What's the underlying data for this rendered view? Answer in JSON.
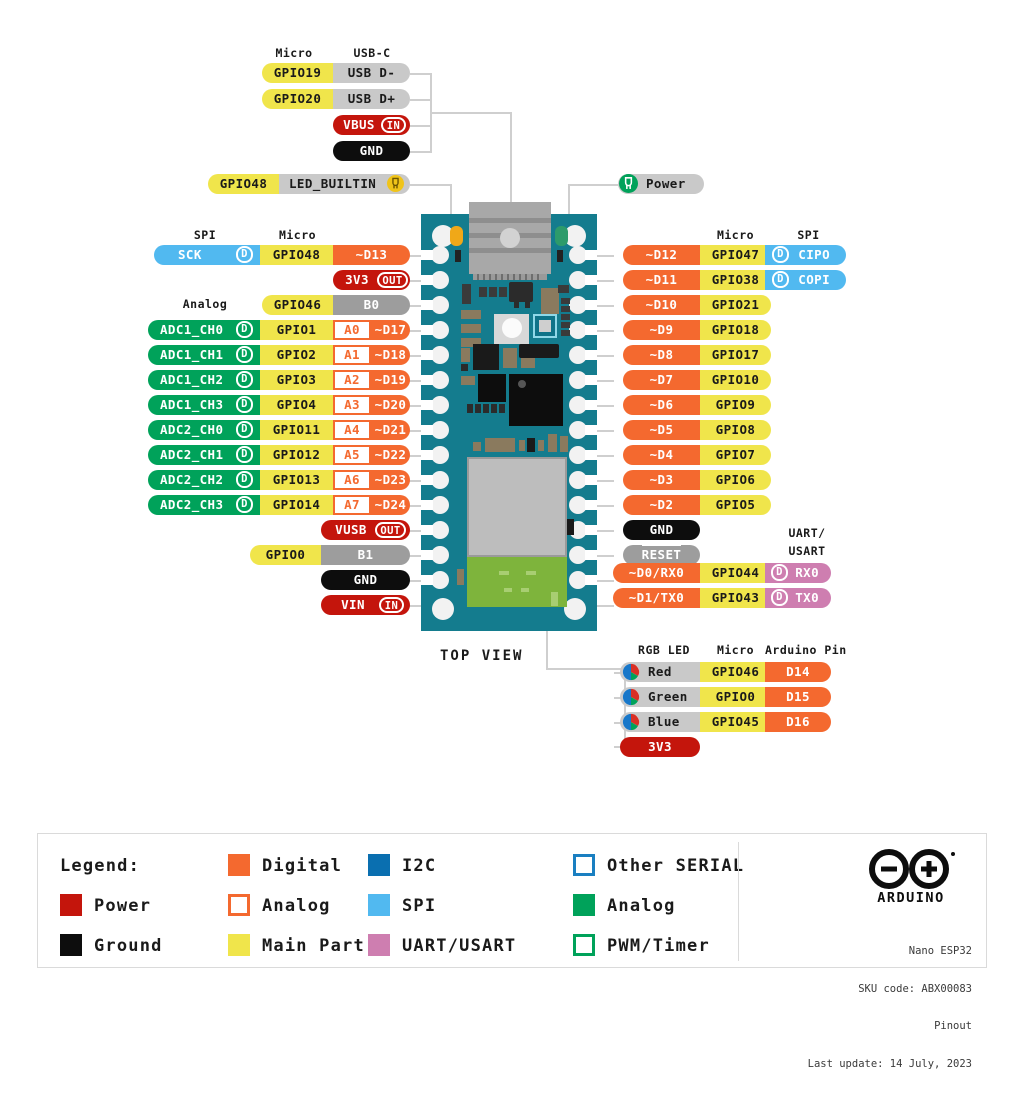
{
  "meta": {
    "title": "Arduino Nano ESP32 Pinout",
    "top_view_label": "TOP VIEW"
  },
  "headers": {
    "usb_micro": "Micro",
    "usb_c": "USB-C",
    "left_spi": "SPI",
    "left_micro": "Micro",
    "left_analog": "Analog",
    "right_micro": "Micro",
    "right_spi": "SPI",
    "right_uart": "UART/",
    "right_uart2": "USART",
    "rgb_led": "RGB LED",
    "rgb_micro": "Micro",
    "rgb_arduino_pin": "Arduino Pin"
  },
  "usb_block": [
    {
      "micro": "GPIO19",
      "name": "USB D-",
      "badge": ""
    },
    {
      "micro": "GPIO20",
      "name": "USB D+",
      "badge": ""
    },
    {
      "micro": "",
      "name": "VBUS",
      "badge": "IN"
    },
    {
      "micro": "",
      "name": "GND",
      "badge": ""
    }
  ],
  "led_builtin": {
    "micro": "GPIO48",
    "name": "LED_BUILTIN",
    "icon": "led-icon"
  },
  "power_led": {
    "name": "Power",
    "icon": "led-icon"
  },
  "left_pins": [
    {
      "spi": "SCK",
      "spi_badge": "D",
      "micro": "GPIO48",
      "analog": "",
      "digital": "~D13",
      "type": "digital"
    },
    {
      "spi": "",
      "spi_badge": "",
      "micro": "",
      "analog": "",
      "digital": "3V3",
      "badge": "OUT",
      "type": "power"
    },
    {
      "spi": "",
      "spi_badge": "",
      "micro": "GPIO46",
      "analog": "",
      "digital": "B0",
      "type": "gray"
    },
    {
      "adc": "ADC1_CH0",
      "adc_badge": "D",
      "micro": "GPIO1",
      "analog": "A0",
      "digital": "~D17",
      "type": "digital"
    },
    {
      "adc": "ADC1_CH1",
      "adc_badge": "D",
      "micro": "GPIO2",
      "analog": "A1",
      "digital": "~D18",
      "type": "digital"
    },
    {
      "adc": "ADC1_CH2",
      "adc_badge": "D",
      "micro": "GPIO3",
      "analog": "A2",
      "digital": "~D19",
      "type": "digital"
    },
    {
      "adc": "ADC1_CH3",
      "adc_badge": "D",
      "micro": "GPIO4",
      "analog": "A3",
      "digital": "~D20",
      "type": "digital"
    },
    {
      "adc": "ADC2_CH0",
      "adc_badge": "D",
      "micro": "GPIO11",
      "analog": "A4",
      "digital": "~D21",
      "type": "digital"
    },
    {
      "adc": "ADC2_CH1",
      "adc_badge": "D",
      "micro": "GPIO12",
      "analog": "A5",
      "digital": "~D22",
      "type": "digital"
    },
    {
      "adc": "ADC2_CH2",
      "adc_badge": "D",
      "micro": "GPIO13",
      "analog": "A6",
      "digital": "~D23",
      "type": "digital"
    },
    {
      "adc": "ADC2_CH3",
      "adc_badge": "D",
      "micro": "GPIO14",
      "analog": "A7",
      "digital": "~D24",
      "type": "digital"
    },
    {
      "spi": "",
      "micro": "",
      "analog": "",
      "digital": "VUSB",
      "badge": "OUT",
      "type": "power"
    },
    {
      "spi": "",
      "micro": "GPIO0",
      "analog": "",
      "digital": "B1",
      "type": "gray"
    },
    {
      "spi": "",
      "micro": "",
      "analog": "",
      "digital": "GND",
      "type": "ground"
    },
    {
      "spi": "",
      "micro": "",
      "analog": "",
      "digital": "VIN",
      "badge": "IN",
      "type": "power"
    }
  ],
  "right_pins": [
    {
      "digital": "~D12",
      "type": "digital",
      "micro": "GPIO47",
      "alt": "CIPO",
      "alt_badge": "D",
      "alt_type": "spi"
    },
    {
      "digital": "~D11",
      "type": "digital",
      "micro": "GPIO38",
      "alt": "COPI",
      "alt_badge": "D",
      "alt_type": "spi"
    },
    {
      "digital": "~D10",
      "type": "digital",
      "micro": "GPIO21",
      "alt": "",
      "alt_type": ""
    },
    {
      "digital": "~D9",
      "type": "digital",
      "micro": "GPIO18",
      "alt": "",
      "alt_type": ""
    },
    {
      "digital": "~D8",
      "type": "digital",
      "micro": "GPIO17",
      "alt": "",
      "alt_type": ""
    },
    {
      "digital": "~D7",
      "type": "digital",
      "micro": "GPIO10",
      "alt": "",
      "alt_type": ""
    },
    {
      "digital": "~D6",
      "type": "digital",
      "micro": "GPIO9",
      "alt": "",
      "alt_type": ""
    },
    {
      "digital": "~D5",
      "type": "digital",
      "micro": "GPIO8",
      "alt": "",
      "alt_type": ""
    },
    {
      "digital": "~D4",
      "type": "digital",
      "micro": "GPIO7",
      "alt": "",
      "alt_type": ""
    },
    {
      "digital": "~D3",
      "type": "digital",
      "micro": "GPIO6",
      "alt": "",
      "alt_type": ""
    },
    {
      "digital": "~D2",
      "type": "digital",
      "micro": "GPIO5",
      "alt": "",
      "alt_type": ""
    },
    {
      "digital": "GND",
      "type": "ground",
      "micro": "",
      "alt": "",
      "alt_type": ""
    },
    {
      "digital": "RESET",
      "type": "gray",
      "overline": true,
      "micro": "",
      "alt": "",
      "alt_type": ""
    },
    {
      "digital": "~D0/RX0",
      "type": "digital",
      "micro": "GPIO44",
      "alt": "RX0",
      "alt_badge": "D",
      "alt_type": "uart"
    },
    {
      "digital": "~D1/TX0",
      "type": "digital",
      "micro": "GPIO43",
      "alt": "TX0",
      "alt_badge": "D",
      "alt_type": "uart"
    }
  ],
  "rgb_rows": [
    {
      "color": "Red",
      "micro": "GPIO46",
      "pin": "D14",
      "icon": "rgb-led-icon"
    },
    {
      "color": "Green",
      "micro": "GPIO0",
      "pin": "D15",
      "icon": "rgb-led-icon"
    },
    {
      "color": "Blue",
      "micro": "GPIO45",
      "pin": "D16",
      "icon": "rgb-led-icon"
    }
  ],
  "rgb_power": {
    "label": "3V3"
  },
  "legend": {
    "title": "Legend:",
    "items": [
      {
        "label": "Power",
        "color": "#C4150C",
        "filled": true,
        "col": 0,
        "row": 1
      },
      {
        "label": "Ground",
        "color": "#0d0d0d",
        "filled": true,
        "col": 0,
        "row": 2
      },
      {
        "label": "Digital",
        "color": "#F4692F",
        "filled": true,
        "col": 1,
        "row": 0
      },
      {
        "label": "Analog",
        "color": "#F4692F",
        "filled": false,
        "col": 1,
        "row": 1
      },
      {
        "label": "Main Part",
        "color": "#F0E54B",
        "filled": true,
        "col": 1,
        "row": 2
      },
      {
        "label": "I2C",
        "color": "#0A6FB0",
        "filled": true,
        "col": 2,
        "row": 0
      },
      {
        "label": "SPI",
        "color": "#51B9F0",
        "filled": true,
        "col": 2,
        "row": 1
      },
      {
        "label": "UART/USART",
        "color": "#CE7EB0",
        "filled": true,
        "col": 2,
        "row": 2
      },
      {
        "label": "Other SERIAL",
        "color": "#1A7FC1",
        "filled": false,
        "col": 3,
        "row": 0
      },
      {
        "label": "Analog",
        "color": "#00A25A",
        "filled": true,
        "col": 3,
        "row": 1
      },
      {
        "label": "PWM/Timer",
        "color": "#00A25A",
        "filled": false,
        "col": 3,
        "row": 2
      }
    ],
    "brand": "ARDUINO",
    "product": "Nano ESP32",
    "sku": "SKU code: ABX00083",
    "doc_type": "Pinout",
    "last_update": "Last update: 14 July, 2023"
  },
  "colors": {
    "digital": "#F4692F",
    "micro_yellow": "#F0E54B",
    "power_red": "#C4150C",
    "ground_black": "#0d0d0d",
    "spi_blue": "#51B9F0",
    "i2c_blue": "#0A6FB0",
    "analog_green": "#00A25A",
    "uart_pink": "#CE7EB0",
    "pcb_teal": "#147C8E",
    "wire_gray": "#CFCFCF"
  }
}
